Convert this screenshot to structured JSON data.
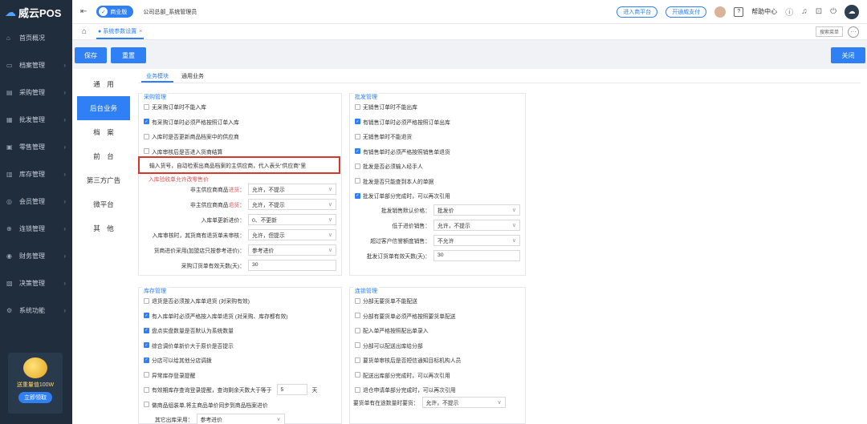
{
  "app": {
    "name": "威云POS"
  },
  "sidebar": {
    "items": [
      {
        "label": "首页概况",
        "icon": "home-icon",
        "glyph": "⌂",
        "arrow": ""
      },
      {
        "label": "档案管理",
        "icon": "archive-icon",
        "glyph": "▭",
        "arrow": "›"
      },
      {
        "label": "采购管理",
        "icon": "purchase-icon",
        "glyph": "▤",
        "arrow": "›"
      },
      {
        "label": "批发管理",
        "icon": "wholesale-icon",
        "glyph": "▦",
        "arrow": "›"
      },
      {
        "label": "零售管理",
        "icon": "retail-icon",
        "glyph": "▣",
        "arrow": "›"
      },
      {
        "label": "库存管理",
        "icon": "inventory-icon",
        "glyph": "▥",
        "arrow": "›"
      },
      {
        "label": "会员管理",
        "icon": "member-icon",
        "glyph": "◎",
        "arrow": "›"
      },
      {
        "label": "连锁管理",
        "icon": "chain-icon",
        "glyph": "⊕",
        "arrow": "›"
      },
      {
        "label": "财务管理",
        "icon": "finance-icon",
        "glyph": "◉",
        "arrow": "›"
      },
      {
        "label": "决策管理",
        "icon": "decision-icon",
        "glyph": "▧",
        "arrow": "›"
      },
      {
        "label": "系统功能",
        "icon": "settings-icon",
        "glyph": "⚙",
        "arrow": "›"
      }
    ],
    "promo": {
      "text": "送重量值100W",
      "button": "立即领取"
    }
  },
  "topbar": {
    "edition": "商业版",
    "company": "公司总部_系统管理员",
    "links": [
      "进入商平台",
      "开通威支付"
    ],
    "help": "帮助中心",
    "cloud_glyph": "☁"
  },
  "tabs": {
    "current": "系统参数设置",
    "close": "×",
    "search_placeholder": "搜索菜单",
    "more": "···"
  },
  "toolbar": {
    "save": "保存",
    "reset": "重置",
    "close": "关闭"
  },
  "left_tabs": [
    "通　用",
    "后台业务",
    "档　案",
    "前　台",
    "第三方广告",
    "微平台",
    "其　他"
  ],
  "sub_tabs": [
    "业务模块",
    "通用业务"
  ],
  "purchase": {
    "title": "采购管理",
    "checks": [
      {
        "label": "无采购订单时不能入库",
        "checked": false
      },
      {
        "label": "有采购订单时必须严格按照订单入库",
        "checked": true
      },
      {
        "label": "入库时是否更新商品档案中的供应商",
        "checked": false
      },
      {
        "label": "入库审核后是否进入货商结算",
        "checked": false
      }
    ],
    "tooltip": "输入货号，自动检索出商品档案的主供应商，代入表头\"供应商\"里",
    "red_label": "入库验收单允许改零售价",
    "fields": [
      {
        "label": "非主供应商商品",
        "hl": "进货",
        "suffix": "：",
        "value": "允许，不提示",
        "type": "select"
      },
      {
        "label": "非主供应商商品",
        "hl": "退货",
        "suffix": "：",
        "value": "允许，不提示",
        "type": "select"
      },
      {
        "label": "入库单更新进价：",
        "hl": "",
        "suffix": "",
        "value": "0、不更新",
        "type": "select"
      },
      {
        "label": "入库审核时，其货商有退货单未审核：",
        "hl": "",
        "suffix": "",
        "value": "允许，但提示",
        "type": "select"
      },
      {
        "label": "货商进价采用(加盟店只按参考进价)：",
        "hl": "",
        "suffix": "",
        "value": "参考进价",
        "type": "select"
      },
      {
        "label": "采购订货单有效天数(天)：",
        "hl": "",
        "suffix": "",
        "value": "30",
        "type": "input"
      }
    ]
  },
  "wholesale": {
    "title": "批发管理",
    "checks": [
      {
        "label": "无销售订单时不能出库",
        "checked": false
      },
      {
        "label": "有销售订单时必须严格按照订单出库",
        "checked": true
      },
      {
        "label": "无销售单时不能退货",
        "checked": false
      },
      {
        "label": "有销售单时必须严格按照销售单退货",
        "checked": true
      },
      {
        "label": "批发是否必须输入经手人",
        "checked": false
      },
      {
        "label": "批发是否只能查到本人的单据",
        "checked": false
      },
      {
        "label": "批发订单部分完成时，可以再次引用",
        "checked": true
      }
    ],
    "fields": [
      {
        "label": "批发销售默认价格：",
        "hl": "",
        "suffix": "",
        "value": "批发价",
        "type": "select"
      },
      {
        "label": "低于进价销售：",
        "hl": "",
        "suffix": "",
        "value": "允许，不提示",
        "type": "select"
      },
      {
        "label": "超过客户信誉额度销售：",
        "hl": "",
        "suffix": "",
        "value": "不允许",
        "type": "select"
      },
      {
        "label": "批发订货单有效天数(天)：",
        "hl": "",
        "suffix": "",
        "value": "30",
        "type": "input"
      }
    ]
  },
  "inventory": {
    "title": "库存管理",
    "checks": [
      {
        "label": "退货是否必须按入库单退货 (对采购有效)",
        "checked": false
      },
      {
        "label": "有入库单时必须严格按入库单退货 (对采购、库存都有效)",
        "checked": true
      },
      {
        "label": "盘点实盘数量是否默认为系统数量",
        "checked": true
      },
      {
        "label": "综合调价单新价大于原价是否提示",
        "checked": true
      },
      {
        "label": "分店可以给其他分店调拨",
        "checked": true
      },
      {
        "label": "异常库存登录提醒",
        "checked": false
      },
      {
        "label": "有效期库存查询登录提醒，查询剩余天数大于等于",
        "checked": false,
        "value": "5",
        "unit": "天"
      },
      {
        "label": "做商品组装单,将主商品单价同步到商品档案进价",
        "checked": false
      }
    ],
    "field": {
      "label": "其它出库采用：",
      "value": "参考进价"
    }
  },
  "chain": {
    "title": "连锁管理",
    "checks": [
      {
        "label": "分部无要货单不能配送",
        "checked": false
      },
      {
        "label": "分部有要货单必须严格按照要货单配送",
        "checked": false
      },
      {
        "label": "配入单严格按照配出单录入",
        "checked": false
      },
      {
        "label": "分部可以配送出库给分部",
        "checked": false
      },
      {
        "label": "要货单审核后是否短信通知目标机构人员",
        "checked": false
      },
      {
        "label": "配送出库部分完成时，可以再次引用",
        "checked": false
      },
      {
        "label": "退仓申请单部分完成时，可以再次引用",
        "checked": false
      }
    ],
    "field": {
      "label": "要货单有在途数量时要货：",
      "value": "允许，不提示"
    }
  }
}
